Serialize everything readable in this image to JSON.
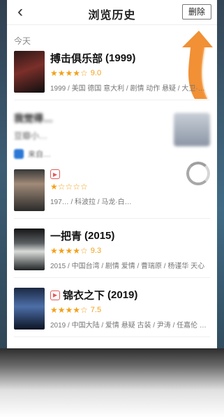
{
  "header": {
    "back_glyph": "‹",
    "title": "浏览历史",
    "delete_label": "删除"
  },
  "history": {
    "section_label": "今天",
    "items": [
      {
        "title": "搏击俱乐部",
        "year": "(1999)",
        "stars": "★★★★☆",
        "score": "9.0",
        "meta": "1999 / 美国 德国 意大利 / 剧情 动作 悬疑 / 大卫·芬奇"
      }
    ],
    "blurred_recommendation": {
      "title": "我觉得…",
      "subtitle": "豆瓣小…",
      "source": "来自…"
    },
    "more_items": [
      {
        "has_play": "true",
        "title": "",
        "year": "",
        "stars": "★☆☆☆☆",
        "score": "",
        "meta": "197… / 科波拉 / 马龙·白…"
      },
      {
        "has_play": "false",
        "title": "一把青",
        "year": "(2015)",
        "stars": "★★★★☆",
        "score": "9.3",
        "meta": "2015 / 中国台湾 / 剧情 爱情 / 曹瑞原 / 杨谨华 天心"
      },
      {
        "has_play": "true",
        "title": "锦衣之下",
        "year": "(2019)",
        "stars": "★★★★☆",
        "score": "7.5",
        "meta": "2019 / 中国大陆 / 爱情 悬疑 古装 / 尹涛 / 任嘉伦 谭松韵"
      }
    ]
  },
  "colors": {
    "accent_orange": "#f08a2a",
    "star_orange": "#f2a11a",
    "play_badge_red": "#e35b5b"
  }
}
